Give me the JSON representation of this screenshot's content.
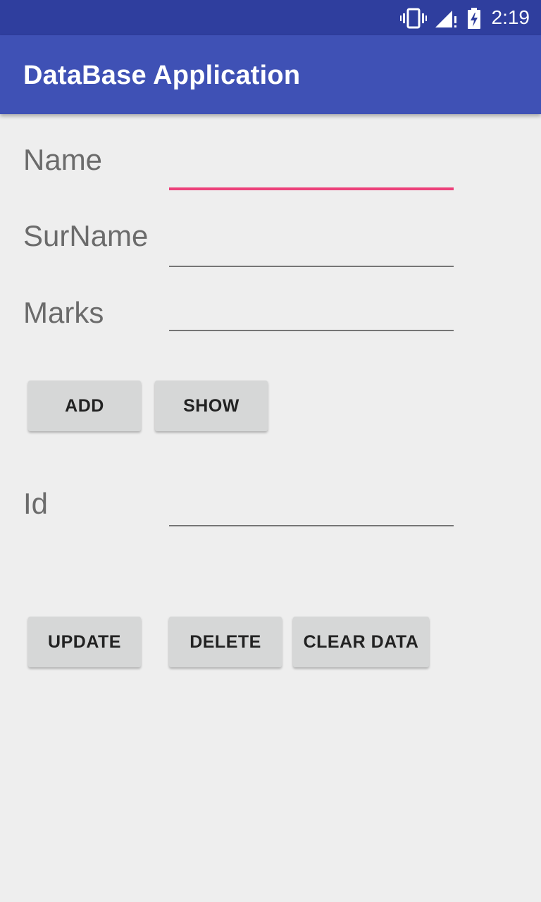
{
  "status_bar": {
    "time": "2:19",
    "icons": [
      "vibrate-icon",
      "signal-icon",
      "battery-charging-icon"
    ],
    "color": "#2F3E9E"
  },
  "app_bar": {
    "title": "DataBase Application",
    "color": "#3F51B5"
  },
  "form": {
    "name_label": "Name",
    "surname_label": "SurName",
    "marks_label": "Marks",
    "id_label": "Id",
    "name_value": "",
    "surname_value": "",
    "marks_value": "",
    "id_value": "",
    "focus_accent_color": "#EC407A"
  },
  "buttons": {
    "add": "ADD",
    "show": "SHOW",
    "update": "UPDATE",
    "delete": "DELETE",
    "clear_data": "CLEAR DATA"
  }
}
